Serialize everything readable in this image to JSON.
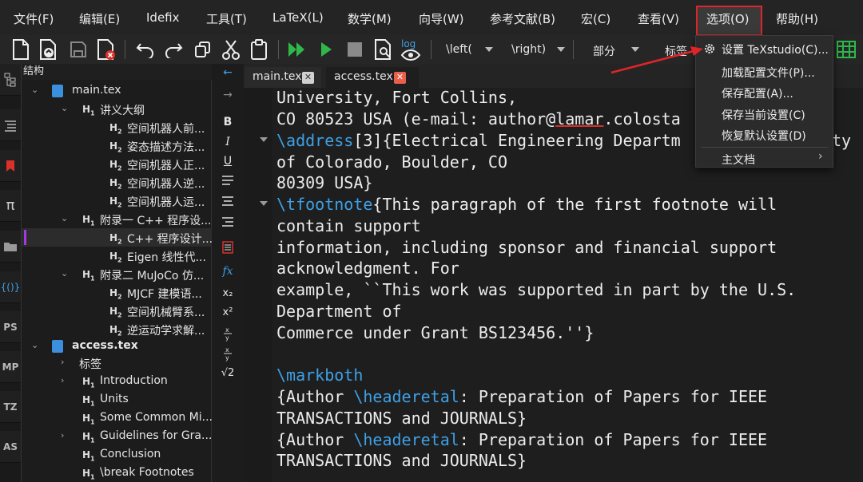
{
  "menubar": {
    "items": [
      "文件(F)",
      "编辑(E)",
      "Idefix",
      "工具(T)",
      "LaTeX(L)",
      "数学(M)",
      "向导(W)",
      "参考文献(B)",
      "宏(C)",
      "查看(V)",
      "选项(O)",
      "帮助(H)"
    ]
  },
  "toolbar": {
    "left_label": "\\left(",
    "right_label": "\\right)",
    "section_label": "部分",
    "tag_label": "标签",
    "log_label": "log"
  },
  "side_tabs": [
    "PS",
    "MP",
    "TZ",
    "AS"
  ],
  "structure": {
    "title": "结构",
    "main": {
      "file": "main.tex",
      "outline": "讲义大纲",
      "outline_items": [
        "空间机器人前...",
        "姿态描述方法...",
        "空间机器人正...",
        "空间机器人逆...",
        "空间机器人运..."
      ],
      "app1": "附录一 C++ 程序设...",
      "app1_items": [
        "C++ 程序设计...",
        "Eigen 线性代..."
      ],
      "app2": "附录二 MuJoCo 仿...",
      "app2_items": [
        "MJCF 建模语...",
        "空间机械臂系...",
        "逆运动学求解..."
      ]
    },
    "access": {
      "file": "access.tex",
      "labels": "标签",
      "items": [
        "Introduction",
        "Units",
        "Some Common Mi...",
        "Guidelines for Gra...",
        "Conclusion",
        "\\break Footnotes"
      ]
    }
  },
  "format_bar": {
    "bold": "B",
    "italic": "I",
    "underline": "U",
    "fx": "fx",
    "sub": "x₂",
    "sup": "x²",
    "sqrt": "√2"
  },
  "tabs": [
    {
      "label": "main.tex",
      "close": "✕"
    },
    {
      "label": "access.tex",
      "close": "✕"
    }
  ],
  "editor": {
    "lines": [
      "University, Fort Collins,",
      "CO 80523 USA (e-mail: author@",
      "lamar",
      ".colosta",
      "\\address",
      "[3]{Electrical Engineering Departm",
      "ty",
      "of Colorado, Boulder, CO",
      "80309 USA}",
      "\\tfootnote",
      "{This paragraph of the first footnote will",
      "contain support",
      "information, including sponsor and financial support",
      "acknowledgment. For",
      "example, ``This work was supported in part by the U.S.",
      "Department of",
      "Commerce under Grant BS123456.''}",
      "\\markboth",
      "{Author ",
      "\\headeretal",
      ": Preparation of Papers for IEEE",
      "TRANSACTIONS and JOURNALS}"
    ]
  },
  "options_menu": {
    "items": [
      "设置 TeXstudio(C)...",
      "加载配置文件(P)...",
      "保存配置(A)...",
      "保存当前设置(C)",
      "恢复默认设置(D)",
      "主文档"
    ]
  },
  "colors": {
    "highlight_box": "#e0242a",
    "keyword": "#3ea0e6",
    "tab_close": "#e8604c",
    "run_green": "#2fb84a"
  }
}
